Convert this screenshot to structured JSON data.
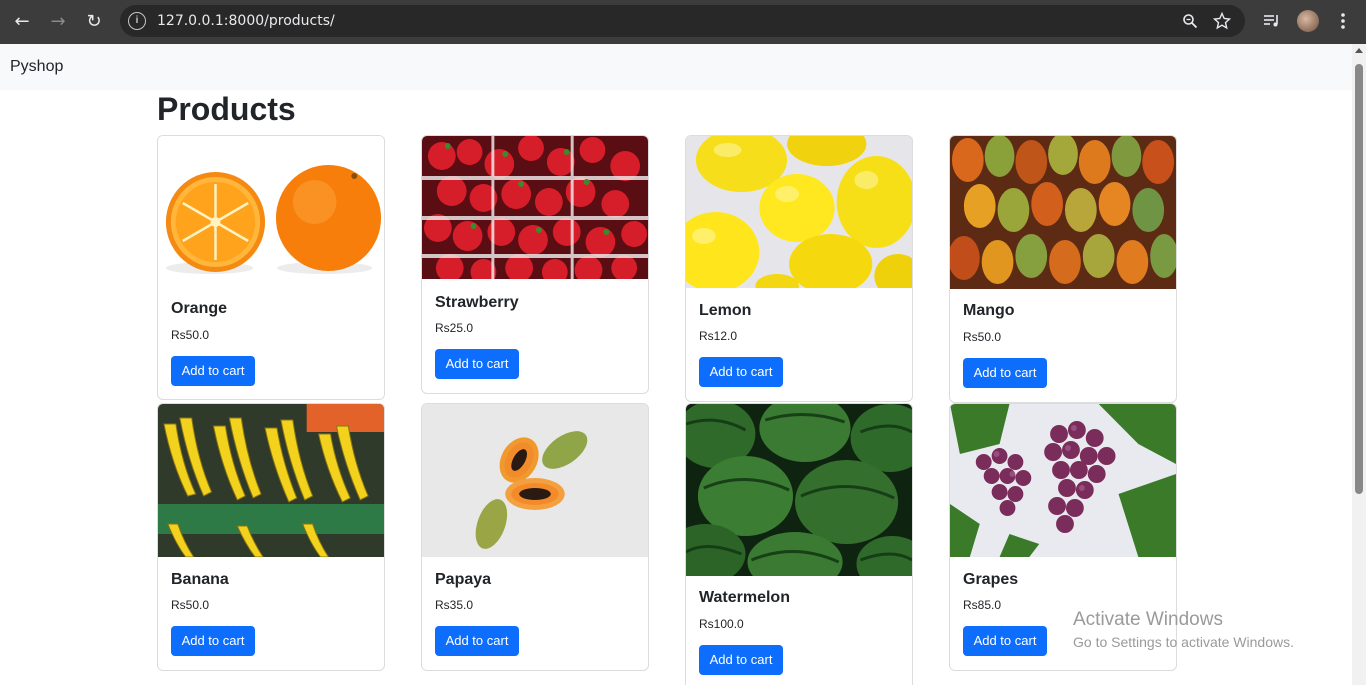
{
  "browser": {
    "url": "127.0.0.1:8000/products/",
    "back_icon": "←",
    "forward_icon": "→",
    "reload_icon": "↻"
  },
  "navbar": {
    "brand": "Pyshop"
  },
  "page": {
    "title": "Products"
  },
  "products": [
    {
      "name": "Orange",
      "price": "Rs50.0",
      "button": "Add to cart"
    },
    {
      "name": "Strawberry",
      "price": "Rs25.0",
      "button": "Add to cart"
    },
    {
      "name": "Lemon",
      "price": "Rs12.0",
      "button": "Add to cart"
    },
    {
      "name": "Mango",
      "price": "Rs50.0",
      "button": "Add to cart"
    },
    {
      "name": "Banana",
      "price": "Rs50.0",
      "button": "Add to cart"
    },
    {
      "name": "Papaya",
      "price": "Rs35.0",
      "button": "Add to cart"
    },
    {
      "name": "Watermelon",
      "price": "Rs100.0",
      "button": "Add to cart"
    },
    {
      "name": "Grapes",
      "price": "Rs85.0",
      "button": "Add to cart"
    }
  ],
  "watermark": {
    "title": "Activate Windows",
    "subtitle": "Go to Settings to activate Windows."
  },
  "colors": {
    "button": "#0d6efd",
    "navbar_bg": "#f8f9fa",
    "chrome_bg": "#3c3c3c"
  }
}
